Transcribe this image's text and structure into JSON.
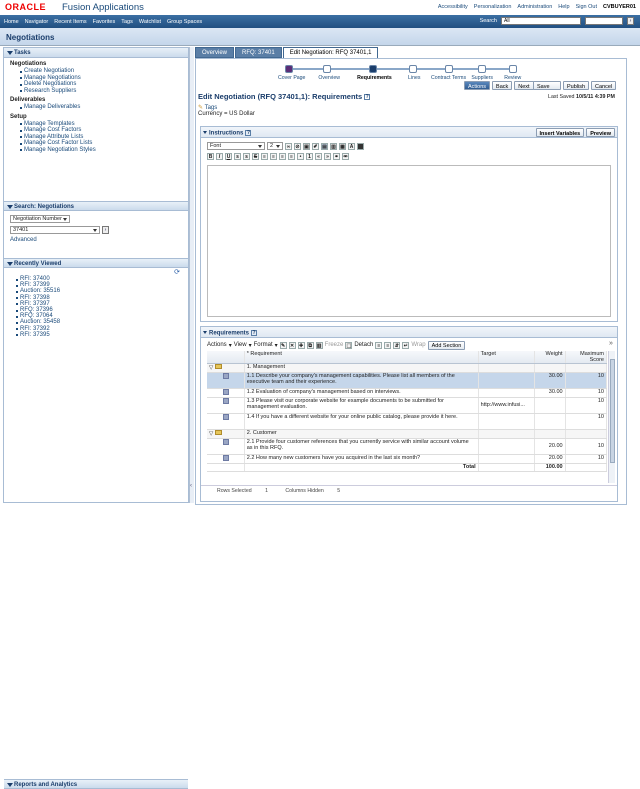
{
  "header": {
    "logo": "ORACLE",
    "app_name": "Fusion Applications",
    "links": [
      "Accessibility",
      "Personalization",
      "Administration",
      "Help",
      "Sign Out"
    ],
    "user": "CVBUYER01"
  },
  "nav": {
    "items": [
      "Home",
      "Navigator",
      "Recent Items",
      "Favorites",
      "Tags",
      "Watchlist",
      "Group Spaces"
    ],
    "search_label": "Search",
    "search_scope": "All"
  },
  "page": {
    "title": "Negotiations"
  },
  "tasks": {
    "title": "Tasks",
    "groups": [
      {
        "name": "Negotiations",
        "links": [
          "Create Negotiation",
          "Manage Negotiations",
          "Delete Negotiations",
          "Research Suppliers"
        ]
      },
      {
        "name": "Deliverables",
        "links": [
          "Manage Deliverables"
        ]
      },
      {
        "name": "Setup",
        "links": [
          "Manage Templates",
          "Manage Cost Factors",
          "Manage Attribute Lists",
          "Manage Cost Factor Lists",
          "Manage Negotiation Styles"
        ]
      }
    ]
  },
  "search": {
    "title": "Search: Negotiations",
    "field": "Negotiation Number",
    "value": "37401",
    "advanced": "Advanced"
  },
  "recent": {
    "title": "Recently Viewed",
    "items": [
      "RFI: 37400",
      "RFI: 37399",
      "Auction: 35516",
      "RFI: 37398",
      "RFI: 37397",
      "RFQ: 37396",
      "RFQ: 37064",
      "Auction: 35458",
      "RFI: 37392",
      "RFI: 37395"
    ]
  },
  "reports": {
    "title": "Reports and Analytics"
  },
  "tabs": [
    "Overview",
    "RFQ: 37401",
    "Edit Negotiation: RFQ 37401,1"
  ],
  "train": {
    "stops": [
      "Cover Page",
      "Overview",
      "Requirements",
      "Lines",
      "Contract Terms",
      "Suppliers",
      "Review"
    ],
    "current": 2
  },
  "actions": {
    "actions": "Actions",
    "back": "Back",
    "next": "Next",
    "save": "Save",
    "submit": "Publish",
    "cancel": "Cancel",
    "last_saved_label": "Last Saved",
    "last_saved": "10/5/11 4:39 PM"
  },
  "heading": {
    "title": "Edit Negotiation (RFQ 37401,1): Requirements",
    "tags": "Tags",
    "currency": "Currency = US Dollar"
  },
  "instructions": {
    "title": "Instructions",
    "insert_vars": "Insert Variables",
    "preview": "Preview",
    "font": "Font",
    "size": "2"
  },
  "requirements": {
    "title": "Requirements",
    "toolbar": {
      "actions": "Actions",
      "view": "View",
      "format": "Format",
      "freeze": "Freeze",
      "detach": "Detach",
      "wrap": "Wrap",
      "add_section": "Add Section"
    },
    "columns": [
      "* Requirement",
      "Target",
      "Weight",
      "Maximum Score"
    ],
    "rows": [
      {
        "type": "section",
        "text": "1. Management",
        "target": "",
        "weight": "",
        "max": ""
      },
      {
        "type": "item",
        "text": "1.1 Describe your company's management capabilities. Please list all members of the executive team and their experience.",
        "target": "",
        "weight": "30.00",
        "max": "10",
        "selected": true
      },
      {
        "type": "item",
        "text": "1.2 Evaluation of company's management based on interviews.",
        "target": "",
        "weight": "30.00",
        "max": "10"
      },
      {
        "type": "item",
        "text": "1.3 Please visit our corporate website for example documents to be submitted for management evaluation.",
        "target": "http://www.infusi...",
        "weight": "",
        "max": "10"
      },
      {
        "type": "item",
        "text": "1.4 If you have a different website for your online public catalog, please provide it here.",
        "target": "",
        "weight": "",
        "max": "10"
      },
      {
        "type": "section",
        "text": "2. Customer",
        "target": "",
        "weight": "",
        "max": ""
      },
      {
        "type": "item",
        "text": "2.1 Provide four customer references that you currently service with similar account volume as in this RFQ.",
        "target": "",
        "weight": "20.00",
        "max": "10"
      },
      {
        "type": "item",
        "text": "2.2 How many new customers have you acquired in the last six month?",
        "target": "",
        "weight": "20.00",
        "max": "10"
      }
    ],
    "total_label": "Total",
    "total": "100.00",
    "rows_selected_label": "Rows Selected",
    "rows_selected": "1",
    "cols_hidden_label": "Columns Hidden",
    "cols_hidden": "5"
  }
}
